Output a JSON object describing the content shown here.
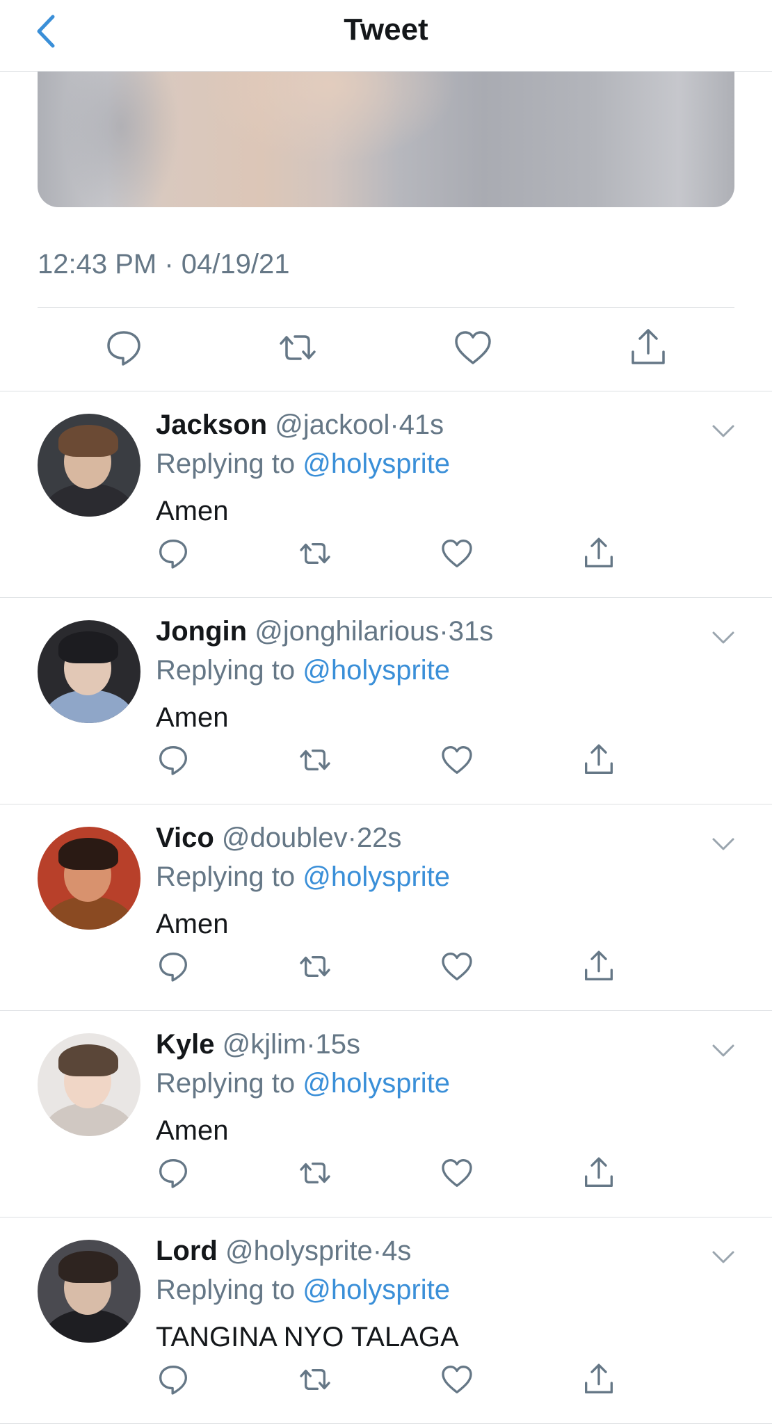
{
  "header": {
    "title": "Tweet",
    "back_icon": "chevron-left-icon",
    "accent_color": "#3a8fd8"
  },
  "tweet": {
    "timestamp": "12:43 PM · 04/19/21",
    "actions": [
      "reply-icon",
      "retweet-icon",
      "like-icon",
      "share-icon"
    ]
  },
  "replies": [
    {
      "name": "Jackson",
      "handle": "@jackool",
      "dot": "·",
      "age": "41s",
      "replying_prefix": "Replying to",
      "replying_to": "@holysprite",
      "text": "Amen"
    },
    {
      "name": "Jongin",
      "handle": "@jonghilarious",
      "dot": "·",
      "age": "31s",
      "replying_prefix": "Replying to",
      "replying_to": "@holysprite",
      "text": "Amen"
    },
    {
      "name": "Vico",
      "handle": "@doublev",
      "dot": "·",
      "age": "22s",
      "replying_prefix": "Replying to",
      "replying_to": "@holysprite",
      "text": "Amen"
    },
    {
      "name": "Kyle",
      "handle": "@kjlim",
      "dot": "·",
      "age": "15s",
      "replying_prefix": "Replying to",
      "replying_to": "@holysprite",
      "text": "Amen"
    },
    {
      "name": "Lord",
      "handle": "@holysprite",
      "dot": "·",
      "age": "4s",
      "replying_prefix": "Replying to",
      "replying_to": "@holysprite",
      "text": "TANGINA NYO TALAGA"
    }
  ],
  "colors": {
    "text_primary": "#14171a",
    "text_secondary": "#657786",
    "link": "#3a8fd8",
    "divider": "#dcdfe2"
  }
}
